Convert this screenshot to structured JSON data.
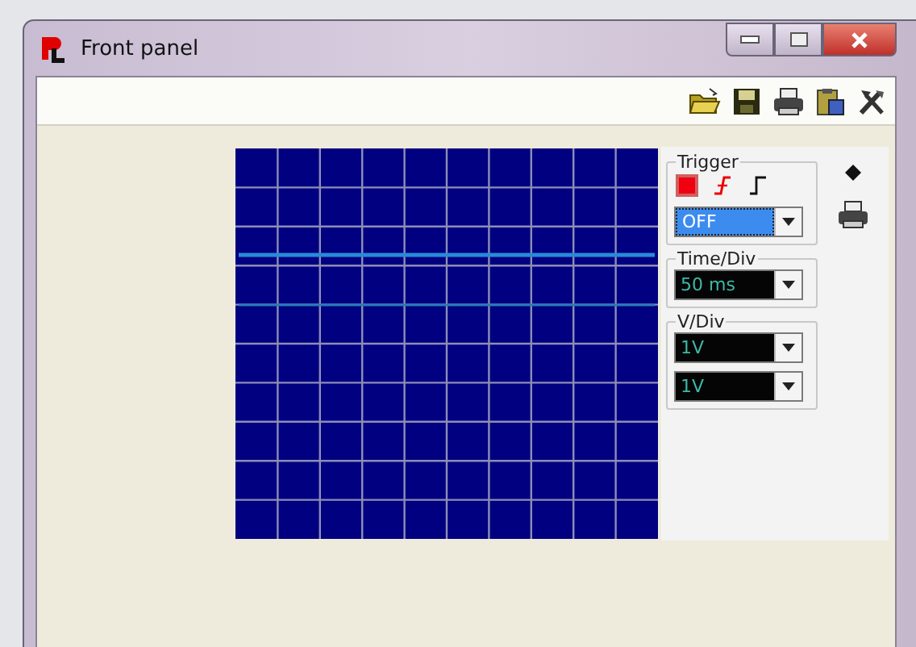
{
  "window": {
    "title": "Front panel"
  },
  "trigger": {
    "title": "Trigger",
    "mode": {
      "value": "OFF",
      "focused": true
    }
  },
  "time_div": {
    "title": "Time/Div",
    "value": "50 ms"
  },
  "v_div": {
    "title": "V/Div",
    "channels": [
      {
        "value": "1V"
      },
      {
        "value": "1V"
      }
    ]
  }
}
